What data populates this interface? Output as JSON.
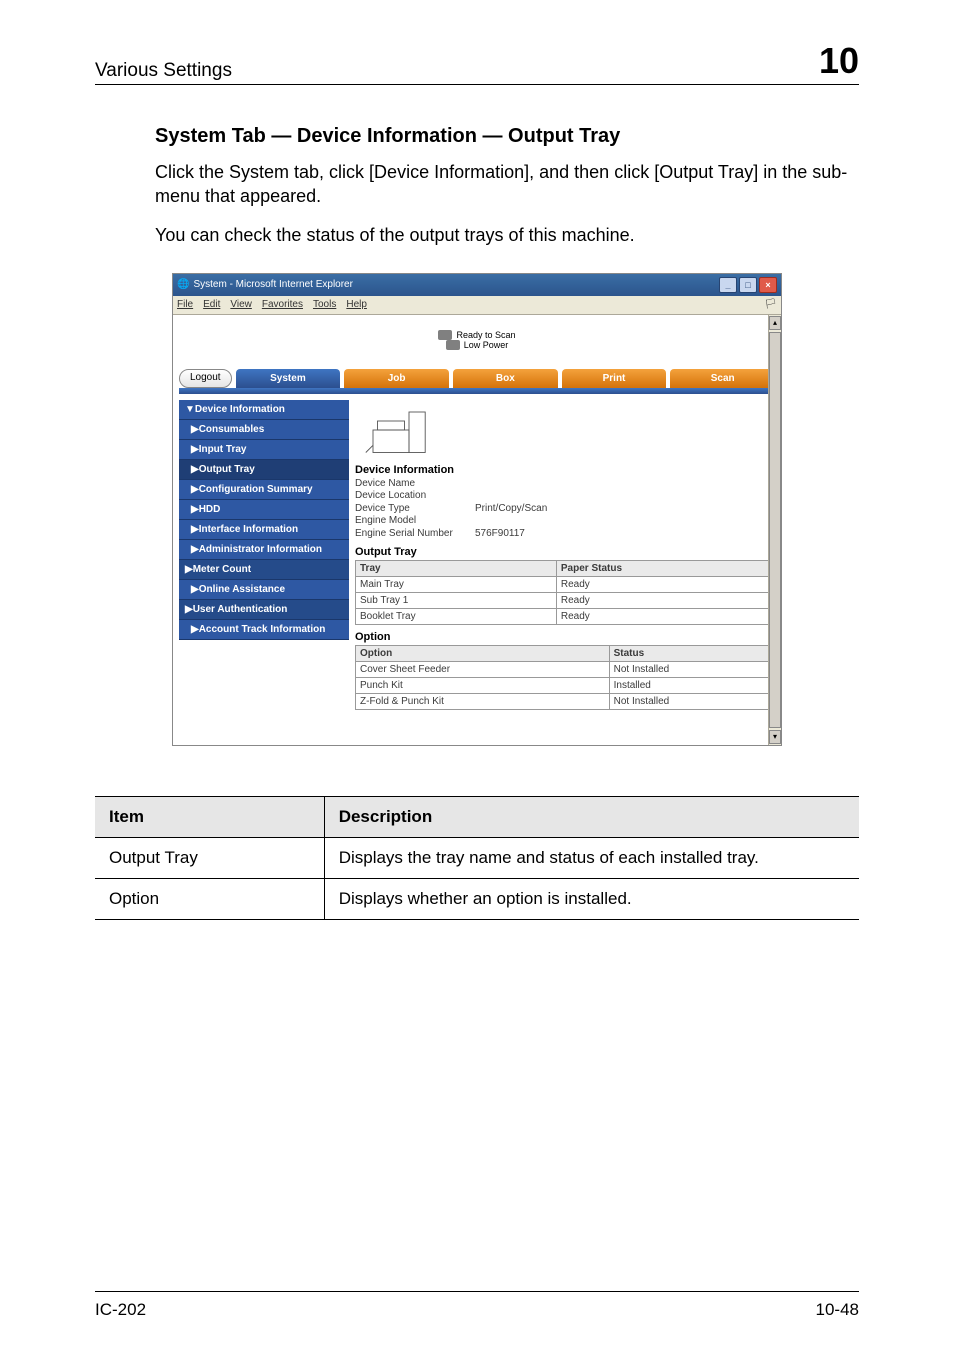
{
  "page_header": {
    "title": "Various Settings",
    "chapter": "10"
  },
  "section_title": "System Tab — Device Information — Output Tray",
  "body_paragraphs": [
    "Click the System tab, click [Device Information], and then click [Output Tray] in the sub-menu that appeared.",
    "You can check the status of the output trays of this machine."
  ],
  "screenshot": {
    "window_title": "System - Microsoft Internet Explorer",
    "menubar": [
      "File",
      "Edit",
      "View",
      "Favorites",
      "Tools",
      "Help"
    ],
    "status": {
      "line1": "Ready to Scan",
      "line2": "Low Power"
    },
    "logout_label": "Logout",
    "tabs": [
      {
        "label": "System",
        "role": "active"
      },
      {
        "label": "Job",
        "role": "orange"
      },
      {
        "label": "Box",
        "role": "orange"
      },
      {
        "label": "Print",
        "role": "orange"
      },
      {
        "label": "Scan",
        "role": "orange"
      }
    ],
    "sidebar": [
      {
        "label": "▼Device Information",
        "cls": "top"
      },
      {
        "label": "▶Consumables",
        "cls": "sub"
      },
      {
        "label": "▶Input Tray",
        "cls": "sub"
      },
      {
        "label": "▶Output Tray",
        "cls": "sub active"
      },
      {
        "label": "▶Configuration Summary",
        "cls": "sub"
      },
      {
        "label": "▶HDD",
        "cls": "sub"
      },
      {
        "label": "▶Interface Information",
        "cls": "sub"
      },
      {
        "label": "▶Administrator Information",
        "cls": "sub"
      },
      {
        "label": "▶Meter Count",
        "cls": "darker"
      },
      {
        "label": "▶Online Assistance",
        "cls": "sub"
      },
      {
        "label": "▶User Authentication",
        "cls": "darker"
      },
      {
        "label": "▶Account Track Information",
        "cls": "sub"
      }
    ],
    "panel": {
      "device_info_heading": "Device Information",
      "device_info": [
        {
          "k": "Device Name",
          "v": ""
        },
        {
          "k": "Device Location",
          "v": ""
        },
        {
          "k": "Device Type",
          "v": "Print/Copy/Scan"
        },
        {
          "k": "Engine Model",
          "v": ""
        },
        {
          "k": "Engine Serial Number",
          "v": "576F90117"
        }
      ],
      "output_tray_heading": "Output Tray",
      "output_tray_cols": [
        "Tray",
        "Paper Status"
      ],
      "output_tray_rows": [
        {
          "c0": "Main Tray",
          "c1": "Ready"
        },
        {
          "c0": "Sub Tray 1",
          "c1": "Ready"
        },
        {
          "c0": "Booklet Tray",
          "c1": "Ready"
        }
      ],
      "option_heading": "Option",
      "option_cols": [
        "Option",
        "Status"
      ],
      "option_rows": [
        {
          "c0": "Cover Sheet Feeder",
          "c1": "Not Installed"
        },
        {
          "c0": "Punch Kit",
          "c1": "Installed"
        },
        {
          "c0": "Z-Fold & Punch Kit",
          "c1": "Not Installed"
        }
      ]
    }
  },
  "item_desc": {
    "header": {
      "item": "Item",
      "desc": "Description"
    },
    "rows": [
      {
        "item": "Output Tray",
        "desc": "Displays the tray name and status of each installed tray."
      },
      {
        "item": "Option",
        "desc": "Displays whether an option is installed."
      }
    ]
  },
  "page_footer": {
    "left": "IC-202",
    "right": "10-48"
  }
}
